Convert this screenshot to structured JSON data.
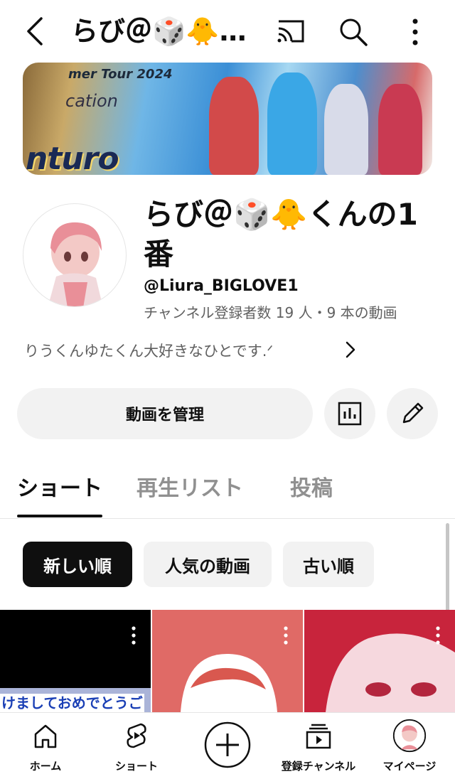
{
  "header": {
    "title": "らび＠🎲🐥…",
    "back_icon": "back-arrow-icon",
    "cast_icon": "cast-icon",
    "search_icon": "search-icon",
    "more_icon": "more-vertical-icon"
  },
  "banner": {
    "tour_text": "mer Tour 2024",
    "logo_text": "nturo",
    "sub_text": "cation"
  },
  "channel": {
    "name": "らび＠🎲🐥くんの1番",
    "handle": "@Liura_BIGLOVE1",
    "meta": "チャンネル登録者数 19 人・9 本の動画",
    "description": "りうくんゆたくん大好きなひとです.ᐟ"
  },
  "actions": {
    "manage_label": "動画を管理",
    "analytics_icon": "analytics-icon",
    "edit_icon": "pencil-icon"
  },
  "tabs": [
    {
      "label": "ショート",
      "active": true
    },
    {
      "label": "再生リスト",
      "active": false
    },
    {
      "label": "投稿",
      "active": false
    }
  ],
  "chips": [
    {
      "label": "新しい順",
      "selected": true
    },
    {
      "label": "人気の動画",
      "selected": false
    },
    {
      "label": "古い順",
      "selected": false
    }
  ],
  "shorts": [
    {
      "caption": "けましておめでとうご"
    },
    {
      "caption": ""
    },
    {
      "caption": ""
    }
  ],
  "bottom_nav": [
    {
      "label": "ホーム",
      "icon": "home-icon"
    },
    {
      "label": "ショート",
      "icon": "shorts-icon"
    },
    {
      "label": "",
      "icon": "create-plus-icon"
    },
    {
      "label": "登録チャンネル",
      "icon": "subscriptions-icon"
    },
    {
      "label": "マイページ",
      "icon": "profile-avatar-icon"
    }
  ],
  "colors": {
    "text_primary": "#0f0f0f",
    "text_secondary": "#606060",
    "chip_bg": "#f2f2f2",
    "chip_selected_bg": "#0f0f0f"
  }
}
